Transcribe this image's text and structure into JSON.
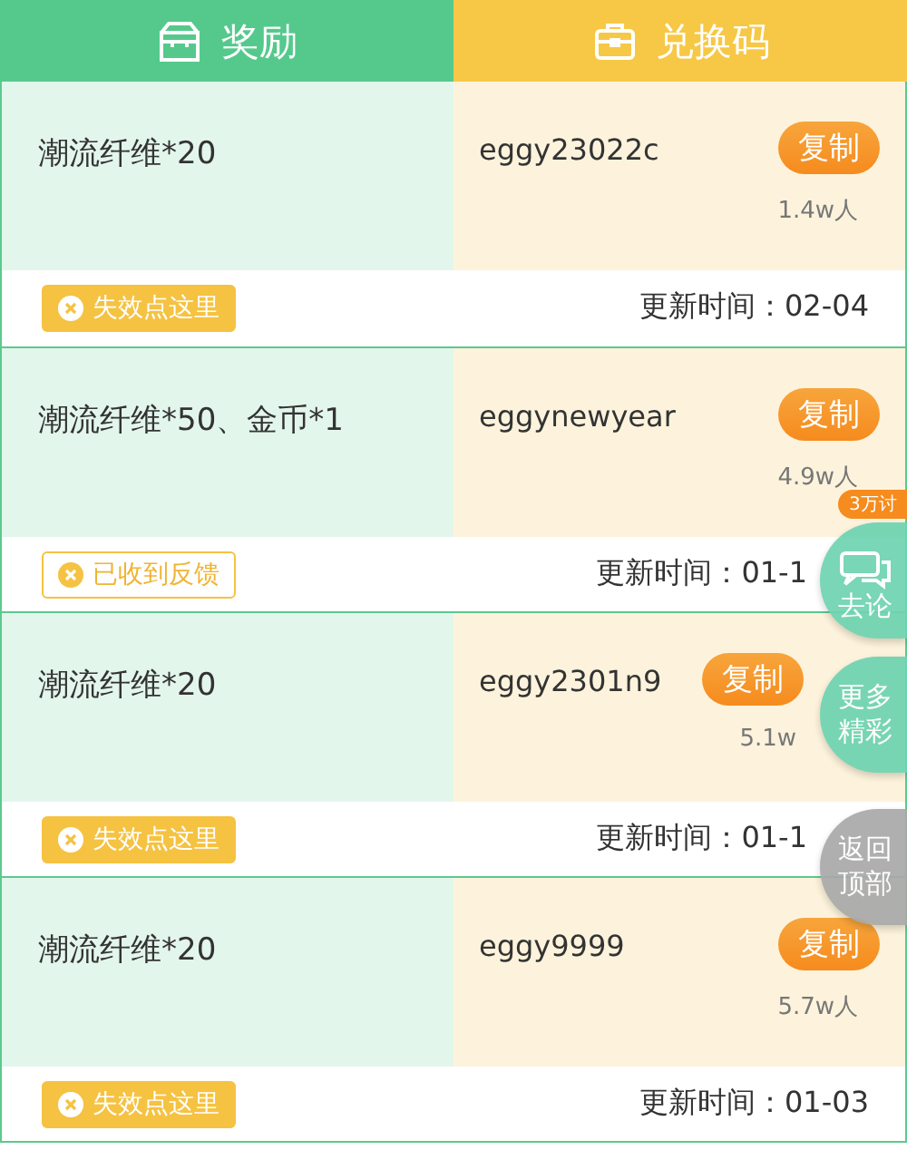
{
  "header": {
    "reward_label": "奖励",
    "code_label": "兑换码"
  },
  "rows": [
    {
      "reward": "潮流纤维*20",
      "code": "eggy23022c",
      "copy": "复制",
      "users": "1.4w人",
      "feedback": "失效点这里",
      "reported": false,
      "updated": "更新时间：02-04"
    },
    {
      "reward": "潮流纤维*50、金币*1",
      "code": "eggynewyear",
      "copy": "复制",
      "users": "4.9w人",
      "feedback": "已收到反馈",
      "reported": true,
      "updated": "更新时间：01-1"
    },
    {
      "reward": "潮流纤维*20",
      "code": "eggy2301n9",
      "copy": "复制",
      "users": "5.1w",
      "feedback": "失效点这里",
      "reported": false,
      "updated": "更新时间：01-1"
    },
    {
      "reward": "潮流纤维*20",
      "code": "eggy9999",
      "copy": "复制",
      "users": "5.7w人",
      "feedback": "失效点这里",
      "reported": false,
      "updated": "更新时间：01-03"
    }
  ],
  "floating": [
    {
      "kind": "forum",
      "badge": "3万讨",
      "lines": [
        "去论"
      ]
    },
    {
      "kind": "more",
      "lines": [
        "更多",
        "精彩"
      ]
    },
    {
      "kind": "top",
      "lines": [
        "返回",
        "顶部"
      ]
    }
  ]
}
